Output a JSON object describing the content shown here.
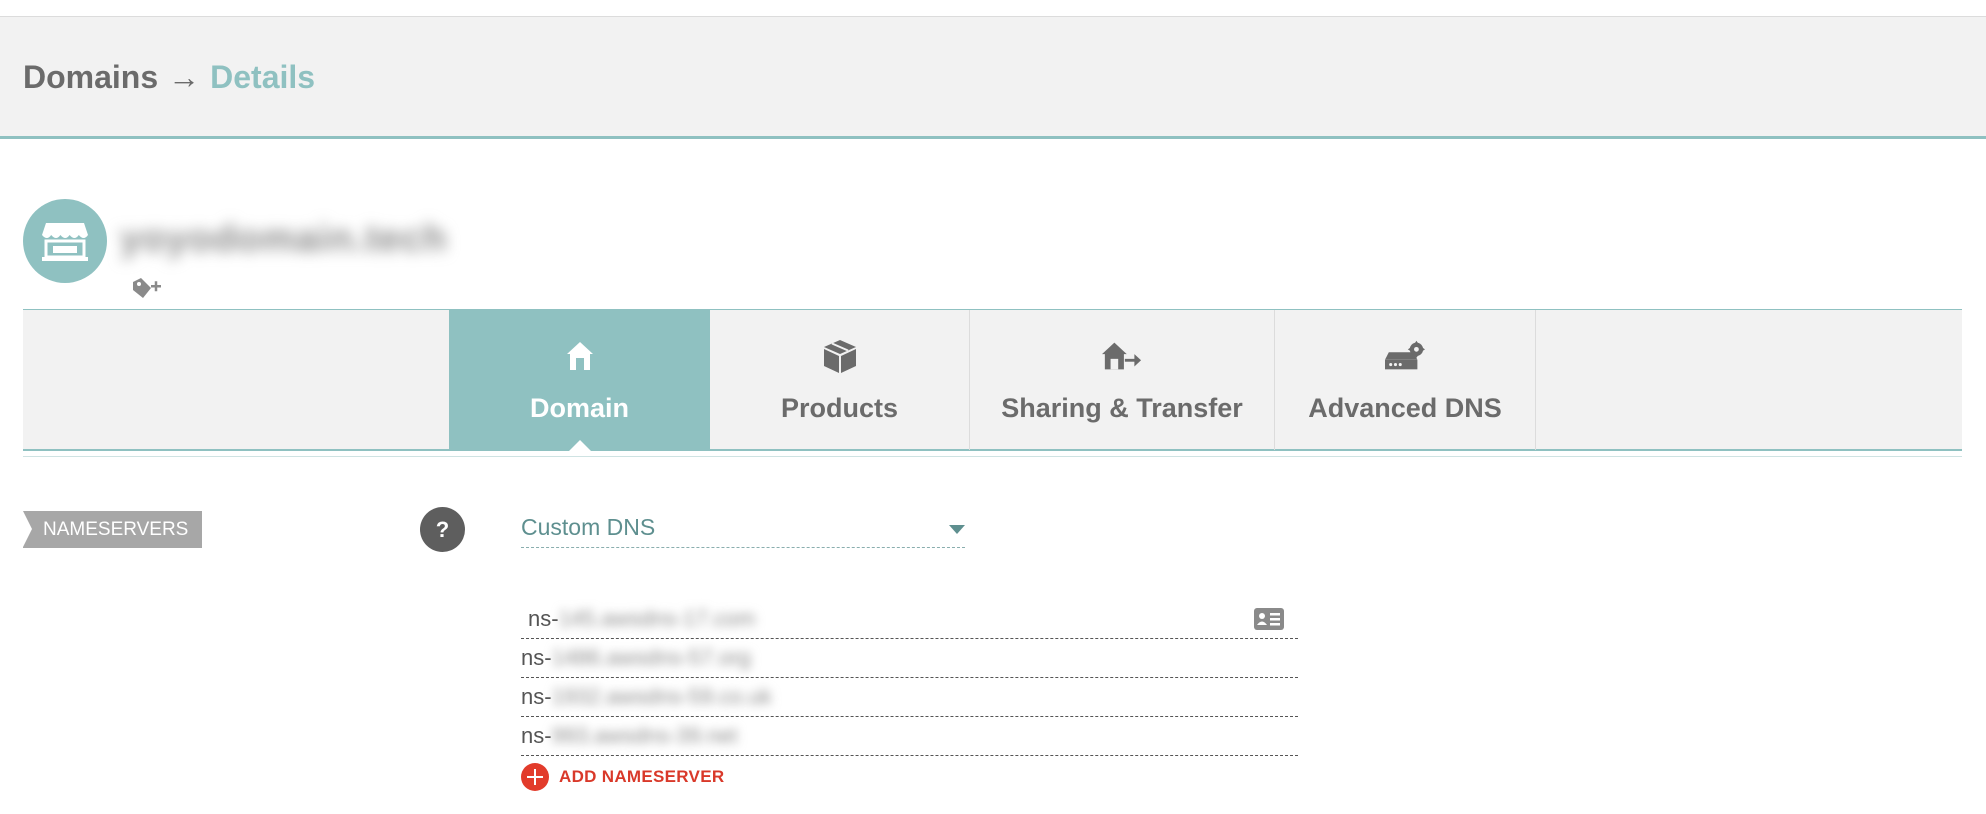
{
  "breadcrumb": {
    "root": "Domains",
    "separator": "→",
    "current": "Details"
  },
  "domain": {
    "name": "yoyodomain.tech",
    "avatar_icon": "storefront-icon",
    "tag_icon": "tag-add-icon"
  },
  "tabs": [
    {
      "label": "Domain",
      "icon": "house-icon",
      "active": true
    },
    {
      "label": "Products",
      "icon": "box-icon",
      "active": false
    },
    {
      "label": "Sharing & Transfer",
      "icon": "house-transfer-icon",
      "active": false
    },
    {
      "label": "Advanced DNS",
      "icon": "server-gear-icon",
      "active": false
    }
  ],
  "nameservers": {
    "section_label": "NAMESERVERS",
    "help_label": "?",
    "dns_type": "Custom DNS",
    "entries": [
      {
        "prefix": "ns-",
        "masked": "145.awsdns-17.com"
      },
      {
        "prefix": "ns-",
        "masked": "1486.awsdns-57.org"
      },
      {
        "prefix": "ns-",
        "masked": "1932.awsdns-59.co.uk"
      },
      {
        "prefix": "ns-",
        "masked": "993.awsdns-39.net"
      }
    ],
    "add_label": "ADD NAMESERVER"
  },
  "colors": {
    "accent": "#8fc1c1",
    "header_bg": "#f2f2f2",
    "add_red": "#e23b2b"
  }
}
